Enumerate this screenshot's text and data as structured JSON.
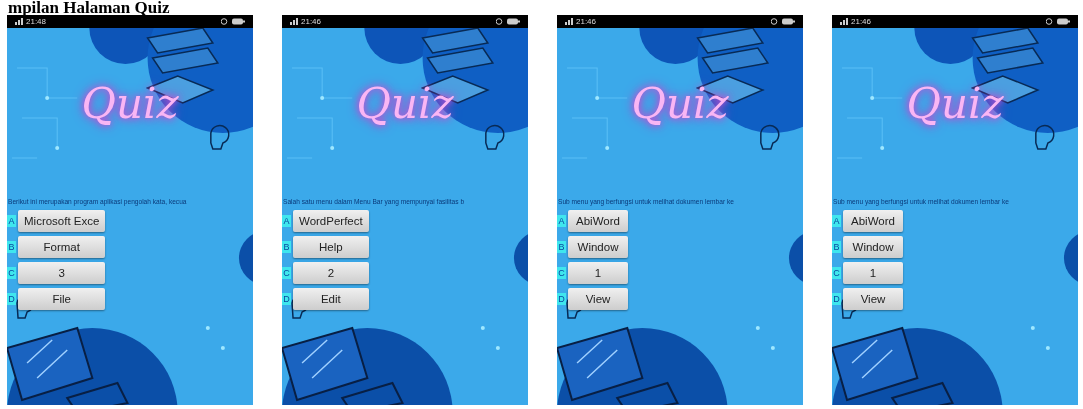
{
  "caption": "mpilan Halaman Quiz",
  "screens": [
    {
      "time": "21:48",
      "title": "Quiz",
      "question": "Berikut ini merupakan program aplikasi pengolah kata, kecua",
      "options": [
        {
          "letter": "A",
          "label": "Microsoft Exce"
        },
        {
          "letter": "B",
          "label": "Format"
        },
        {
          "letter": "C",
          "label": "3"
        },
        {
          "letter": "D",
          "label": "File"
        }
      ]
    },
    {
      "time": "21:46",
      "title": "Quiz",
      "question": "Salah satu menu dalam Menu Bar yang mempunyai fasilitas b",
      "options": [
        {
          "letter": "A",
          "label": "WordPerfect"
        },
        {
          "letter": "B",
          "label": "Help"
        },
        {
          "letter": "C",
          "label": "2"
        },
        {
          "letter": "D",
          "label": "Edit"
        }
      ]
    },
    {
      "time": "21:46",
      "title": "Quiz",
      "question": "Sub menu yang berfungsi untuk melihat dokumen lembar ke",
      "options": [
        {
          "letter": "A",
          "label": "AbiWord"
        },
        {
          "letter": "B",
          "label": "Window"
        },
        {
          "letter": "C",
          "label": "1"
        },
        {
          "letter": "D",
          "label": "View"
        }
      ]
    },
    {
      "time": "21:46",
      "title": "Quiz",
      "question": "Sub menu yang berfungsi untuk melihat dokumen lembar ke",
      "options": [
        {
          "letter": "A",
          "label": "AbiWord"
        },
        {
          "letter": "B",
          "label": "Window"
        },
        {
          "letter": "C",
          "label": "1"
        },
        {
          "letter": "D",
          "label": "View"
        }
      ]
    }
  ]
}
